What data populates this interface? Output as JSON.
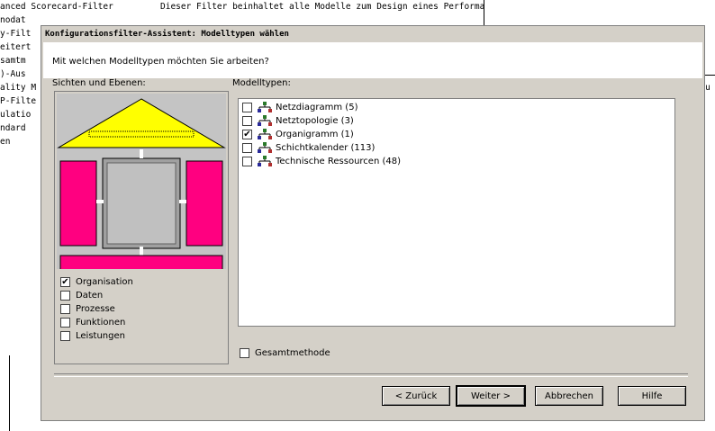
{
  "background": {
    "header_left": "anced Scorecard-Filter",
    "header_right": "Dieser Filter beinhaltet alle Modelle zum Design eines Performance",
    "left_items": [
      "nodat",
      "y-Filt",
      "eitert",
      "samtm",
      ")-Aus",
      "ality M",
      "P-Filte",
      "ulatio",
      "ndard",
      "en"
    ],
    "right_fragment": "ribu"
  },
  "dialog": {
    "title": "Konfigurationsfilter-Assistent: Modelltypen wählen",
    "question": "Mit welchen Modelltypen möchten Sie arbeiten?",
    "views_label": "Sichten und Ebenen:",
    "model_types_label": "Modelltypen:",
    "views": [
      {
        "label": "Organisation",
        "checked": true
      },
      {
        "label": "Daten",
        "checked": false
      },
      {
        "label": "Prozesse",
        "checked": false
      },
      {
        "label": "Funktionen",
        "checked": false
      },
      {
        "label": "Leistungen",
        "checked": false
      }
    ],
    "model_types": [
      {
        "label": "Netzdiagramm (5)",
        "checked": false
      },
      {
        "label": "Netztopologie (3)",
        "checked": false
      },
      {
        "label": "Organigramm (1)",
        "checked": true
      },
      {
        "label": "Schichtkalender (113)",
        "checked": false
      },
      {
        "label": "Technische Ressourcen (48)",
        "checked": false
      }
    ],
    "overall_method": {
      "label": "Gesamtmethode",
      "checked": false
    },
    "buttons": {
      "back": "< Zurück",
      "next": "Weiter >",
      "cancel": "Abbrechen",
      "help": "Hilfe"
    }
  },
  "colors": {
    "roof": "#ffff00",
    "pillars": "#ff0080",
    "center": "#c0c0c0",
    "dialog_bg": "#d4d0c8"
  },
  "icons": {
    "model_type": "network-icon"
  }
}
